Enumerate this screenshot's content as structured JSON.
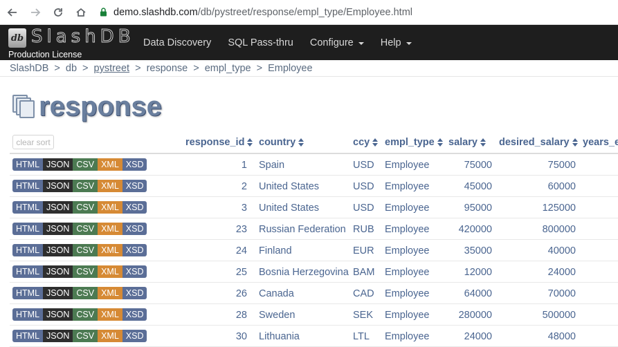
{
  "browser": {
    "url_host": "demo.slashdb.com",
    "url_path": "/db/pystreet/response/empl_type/Employee.html"
  },
  "brand": {
    "logo_text": "db",
    "name": "SlashDB",
    "license": "Production License"
  },
  "nav": {
    "items": [
      {
        "label": "Data Discovery",
        "dropdown": false
      },
      {
        "label": "SQL Pass-thru",
        "dropdown": false
      },
      {
        "label": "Configure",
        "dropdown": true
      },
      {
        "label": "Help",
        "dropdown": true
      }
    ]
  },
  "breadcrumb": [
    "SlashDB",
    "db",
    "pystreet",
    "response",
    "empl_type",
    "Employee"
  ],
  "page": {
    "title": "response",
    "clear_sort_label": "clear sort"
  },
  "table": {
    "columns": [
      "response_id",
      "country",
      "ccy",
      "empl_type",
      "salary",
      "desired_salary",
      "years_e"
    ],
    "format_buttons": [
      "HTML",
      "JSON",
      "CSV",
      "XML",
      "XSD"
    ],
    "rows": [
      {
        "response_id": "1",
        "country": "Spain",
        "ccy": "USD",
        "empl_type": "Employee",
        "salary": "75000",
        "desired_salary": "75000"
      },
      {
        "response_id": "2",
        "country": "United States",
        "ccy": "USD",
        "empl_type": "Employee",
        "salary": "45000",
        "desired_salary": "60000"
      },
      {
        "response_id": "3",
        "country": "United States",
        "ccy": "USD",
        "empl_type": "Employee",
        "salary": "95000",
        "desired_salary": "125000"
      },
      {
        "response_id": "23",
        "country": "Russian Federation",
        "ccy": "RUB",
        "empl_type": "Employee",
        "salary": "420000",
        "desired_salary": "800000"
      },
      {
        "response_id": "24",
        "country": "Finland",
        "ccy": "EUR",
        "empl_type": "Employee",
        "salary": "35000",
        "desired_salary": "40000"
      },
      {
        "response_id": "25",
        "country": "Bosnia Herzegovina",
        "ccy": "BAM",
        "empl_type": "Employee",
        "salary": "12000",
        "desired_salary": "24000"
      },
      {
        "response_id": "26",
        "country": "Canada",
        "ccy": "CAD",
        "empl_type": "Employee",
        "salary": "64000",
        "desired_salary": "70000"
      },
      {
        "response_id": "28",
        "country": "Sweden",
        "ccy": "SEK",
        "empl_type": "Employee",
        "salary": "280000",
        "desired_salary": "500000"
      },
      {
        "response_id": "30",
        "country": "Lithuania",
        "ccy": "LTL",
        "empl_type": "Employee",
        "salary": "24000",
        "desired_salary": "48000"
      }
    ]
  },
  "colors": {
    "navbar": "#1e1e1e",
    "link": "#4a6590",
    "html_btn": "#5b6e97",
    "json_btn": "#2e2e2e",
    "csv_btn": "#4c7a52",
    "xml_btn": "#d68a35",
    "xsd_btn": "#5b6e97"
  }
}
